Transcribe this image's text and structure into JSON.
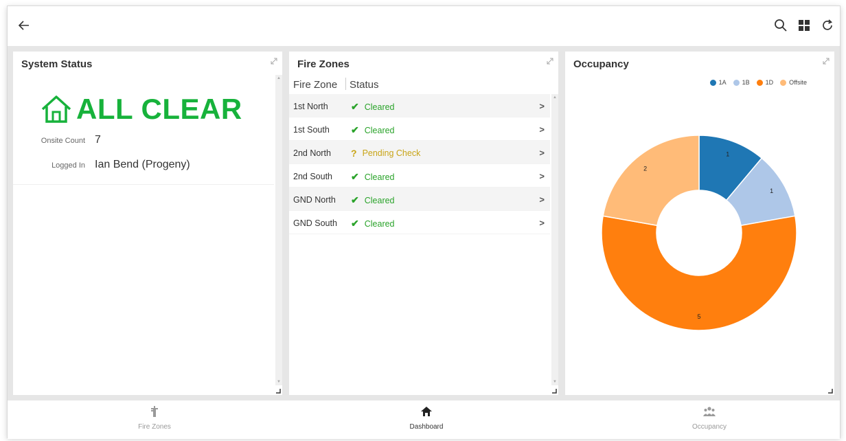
{
  "toolbar": {
    "back_icon": "arrow-left-icon",
    "actions": [
      "search-icon",
      "grid-icon",
      "refresh-icon"
    ]
  },
  "system_status": {
    "title": "System Status",
    "banner": "ALL CLEAR",
    "banner_color": "#17b23b",
    "onsite_label": "Onsite Count",
    "onsite_value": "7",
    "logged_label": "Logged In",
    "logged_value": "Ian Bend (Progeny)"
  },
  "fire_zones": {
    "title": "Fire Zones",
    "col_zone": "Fire Zone",
    "col_status": "Status",
    "rows": [
      {
        "zone": "1st North",
        "status": "Cleared",
        "icon": "✔",
        "state": "ok"
      },
      {
        "zone": "1st South",
        "status": "Cleared",
        "icon": "✔",
        "state": "ok"
      },
      {
        "zone": "2nd North",
        "status": "Pending Check",
        "icon": "?",
        "state": "warn"
      },
      {
        "zone": "2nd South",
        "status": "Cleared",
        "icon": "✔",
        "state": "ok"
      },
      {
        "zone": "GND North",
        "status": "Cleared",
        "icon": "✔",
        "state": "ok"
      },
      {
        "zone": "GND South",
        "status": "Cleared",
        "icon": "✔",
        "state": "ok"
      }
    ]
  },
  "occupancy": {
    "title": "Occupancy"
  },
  "chart_data": {
    "type": "pie",
    "donut": true,
    "categories": [
      "1A",
      "1B",
      "1D",
      "Offsite"
    ],
    "values": [
      1,
      1,
      5,
      2
    ],
    "colors": [
      "#1f77b4",
      "#aec7e8",
      "#ff7f0e",
      "#ffbb78"
    ],
    "legend": "top-right"
  },
  "bottom_nav": [
    {
      "label": "Fire Zones",
      "icon": "fire-hydrant-icon",
      "active": false
    },
    {
      "label": "Dashboard",
      "icon": "home-icon",
      "active": true
    },
    {
      "label": "Occupancy",
      "icon": "users-icon",
      "active": false
    }
  ]
}
